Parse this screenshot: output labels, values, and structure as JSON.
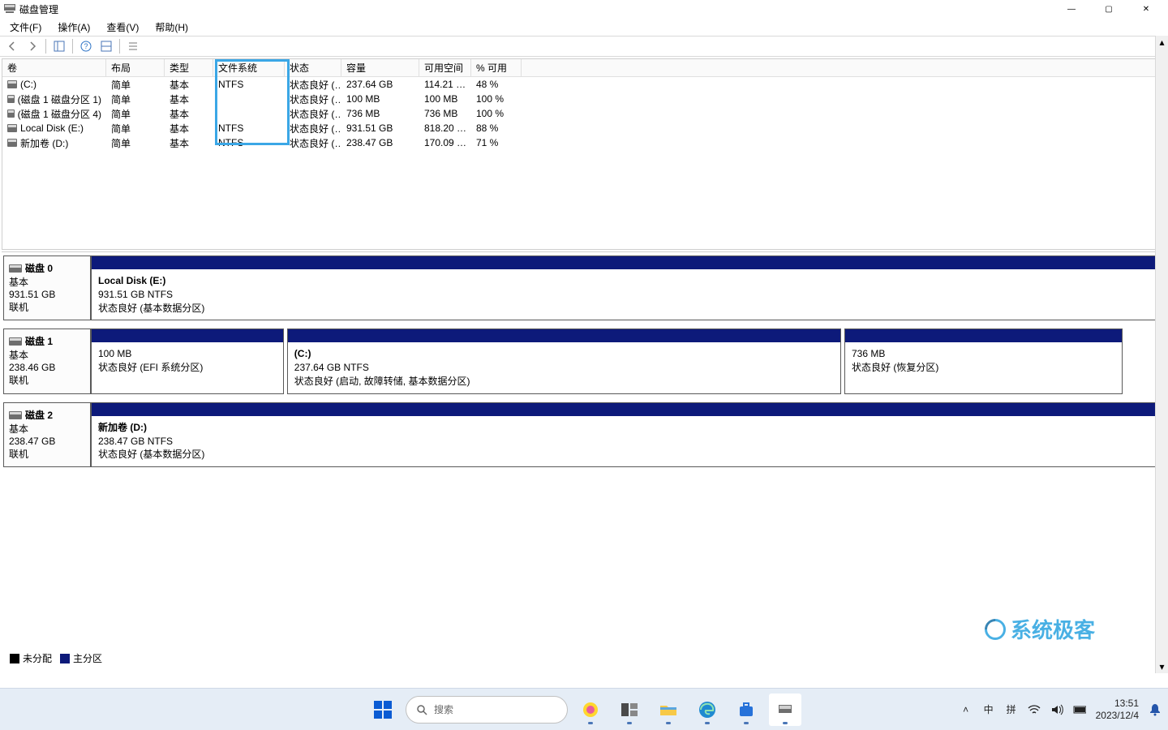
{
  "window": {
    "title": "磁盘管理",
    "controls": {
      "min": "—",
      "max": "▢",
      "close": "✕"
    }
  },
  "menu": {
    "file": "文件(F)",
    "action": "操作(A)",
    "view": "查看(V)",
    "help": "帮助(H)"
  },
  "columns": {
    "volume": "卷",
    "layout": "布局",
    "type": "类型",
    "fs": "文件系统",
    "status": "状态",
    "capacity": "容量",
    "free": "可用空间",
    "pct": "% 可用"
  },
  "volumes": [
    {
      "name": "(C:)",
      "layout": "简单",
      "type": "基本",
      "fs": "NTFS",
      "status": "状态良好 (…",
      "capacity": "237.64 GB",
      "free": "114.21 …",
      "pct": "48 %"
    },
    {
      "name": "(磁盘 1 磁盘分区 1)",
      "layout": "简单",
      "type": "基本",
      "fs": "",
      "status": "状态良好 (…",
      "capacity": "100 MB",
      "free": "100 MB",
      "pct": "100 %"
    },
    {
      "name": "(磁盘 1 磁盘分区 4)",
      "layout": "简单",
      "type": "基本",
      "fs": "",
      "status": "状态良好 (…",
      "capacity": "736 MB",
      "free": "736 MB",
      "pct": "100 %"
    },
    {
      "name": "Local Disk (E:)",
      "layout": "简单",
      "type": "基本",
      "fs": "NTFS",
      "status": "状态良好 (…",
      "capacity": "931.51 GB",
      "free": "818.20 …",
      "pct": "88 %"
    },
    {
      "name": "新加卷 (D:)",
      "layout": "简单",
      "type": "基本",
      "fs": "NTFS",
      "status": "状态良好 (…",
      "capacity": "238.47 GB",
      "free": "170.09 …",
      "pct": "71 %"
    }
  ],
  "disks": [
    {
      "title": "磁盘 0",
      "type": "基本",
      "size": "931.51 GB",
      "state": "联机",
      "parts": [
        {
          "width": 1,
          "title": "Local Disk  (E:)",
          "line2": "931.51 GB NTFS",
          "line3": "状态良好 (基本数据分区)"
        }
      ]
    },
    {
      "title": "磁盘 1",
      "type": "基本",
      "size": "238.46 GB",
      "state": "联机",
      "parts": [
        {
          "width": 0.18,
          "title": "",
          "line2": "100 MB",
          "line3": "状态良好 (EFI 系统分区)"
        },
        {
          "width": 0.52,
          "title": "(C:)",
          "line2": "237.64 GB NTFS",
          "line3": "状态良好 (启动, 故障转储, 基本数据分区)"
        },
        {
          "width": 0.26,
          "title": "",
          "line2": "736 MB",
          "line3": "状态良好 (恢复分区)"
        }
      ]
    },
    {
      "title": "磁盘 2",
      "type": "基本",
      "size": "238.47 GB",
      "state": "联机",
      "parts": [
        {
          "width": 1,
          "title": "新加卷  (D:)",
          "line2": "238.47 GB NTFS",
          "line3": "状态良好 (基本数据分区)"
        }
      ]
    }
  ],
  "legend": {
    "unallocated": "未分配",
    "primary": "主分区"
  },
  "watermark": "系统极客",
  "taskbar": {
    "search_placeholder": "搜索",
    "ime_lang": "中",
    "ime_mode": "拼",
    "time": "13:51",
    "date": "2023/12/4"
  }
}
